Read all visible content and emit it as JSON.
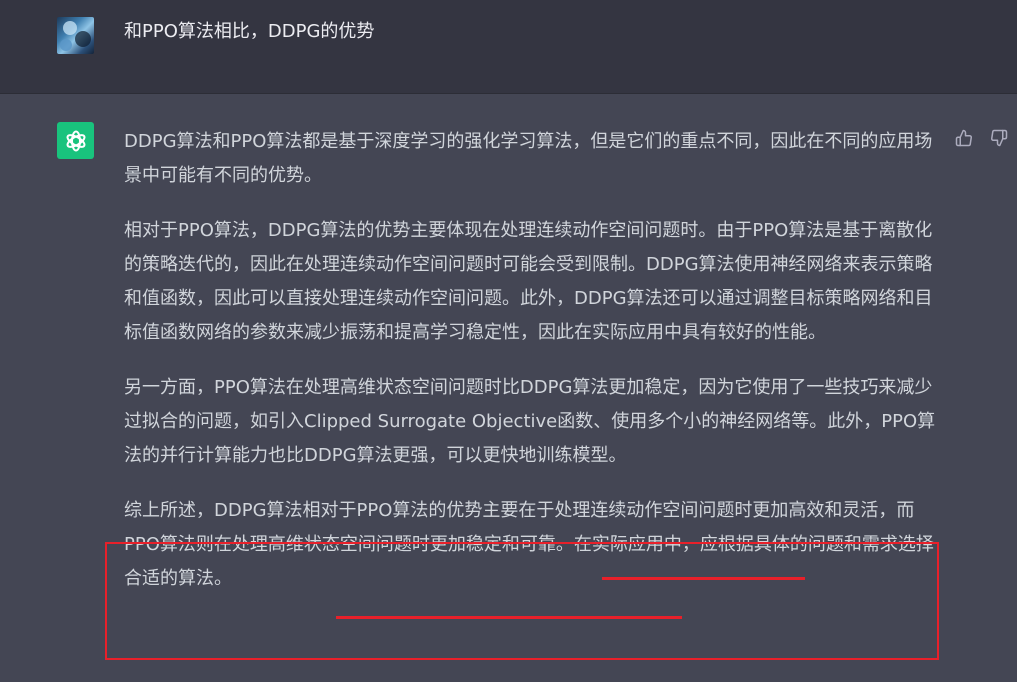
{
  "user_message": {
    "avatar": "user-avatar-image",
    "text": "和PPO算法相比，DDPG的优势"
  },
  "assistant_message": {
    "avatar": "openai-logo-icon",
    "paragraphs": [
      "DDPG算法和PPO算法都是基于深度学习的强化学习算法，但是它们的重点不同，因此在不同的应用场景中可能有不同的优势。",
      "相对于PPO算法，DDPG算法的优势主要体现在处理连续动作空间问题时。由于PPO算法是基于离散化的策略迭代的，因此在处理连续动作空间问题时可能会受到限制。DDPG算法使用神经网络来表示策略和值函数，因此可以直接处理连续动作空间问题。此外，DDPG算法还可以通过调整目标策略网络和目标值函数网络的参数来减少振荡和提高学习稳定性，因此在实际应用中具有较好的性能。",
      "另一方面，PPO算法在处理高维状态空间问题时比DDPG算法更加稳定，因为它使用了一些技巧来减少过拟合的问题，如引入Clipped Surrogate Objective函数、使用多个小的神经网络等。此外，PPO算法的并行计算能力也比DDPG算法更强，可以更快地训练模型。",
      "综上所述，DDPG算法相对于PPO算法的优势主要在于处理连续动作空间问题时更加高效和灵活，而PPO算法则在处理高维状态空间问题时更加稳定和可靠。在实际应用中，应根据具体的问题和需求选择合适的算法。"
    ]
  },
  "feedback": {
    "thumbs_up_icon": "thumbs-up-icon",
    "thumbs_down_icon": "thumbs-down-icon"
  },
  "annotation": {
    "box_color": "#e8202a"
  },
  "colors": {
    "user_bg": "#343541",
    "assistant_bg": "#444654",
    "openai_green": "#19c37d",
    "text": "#d1d5db"
  }
}
